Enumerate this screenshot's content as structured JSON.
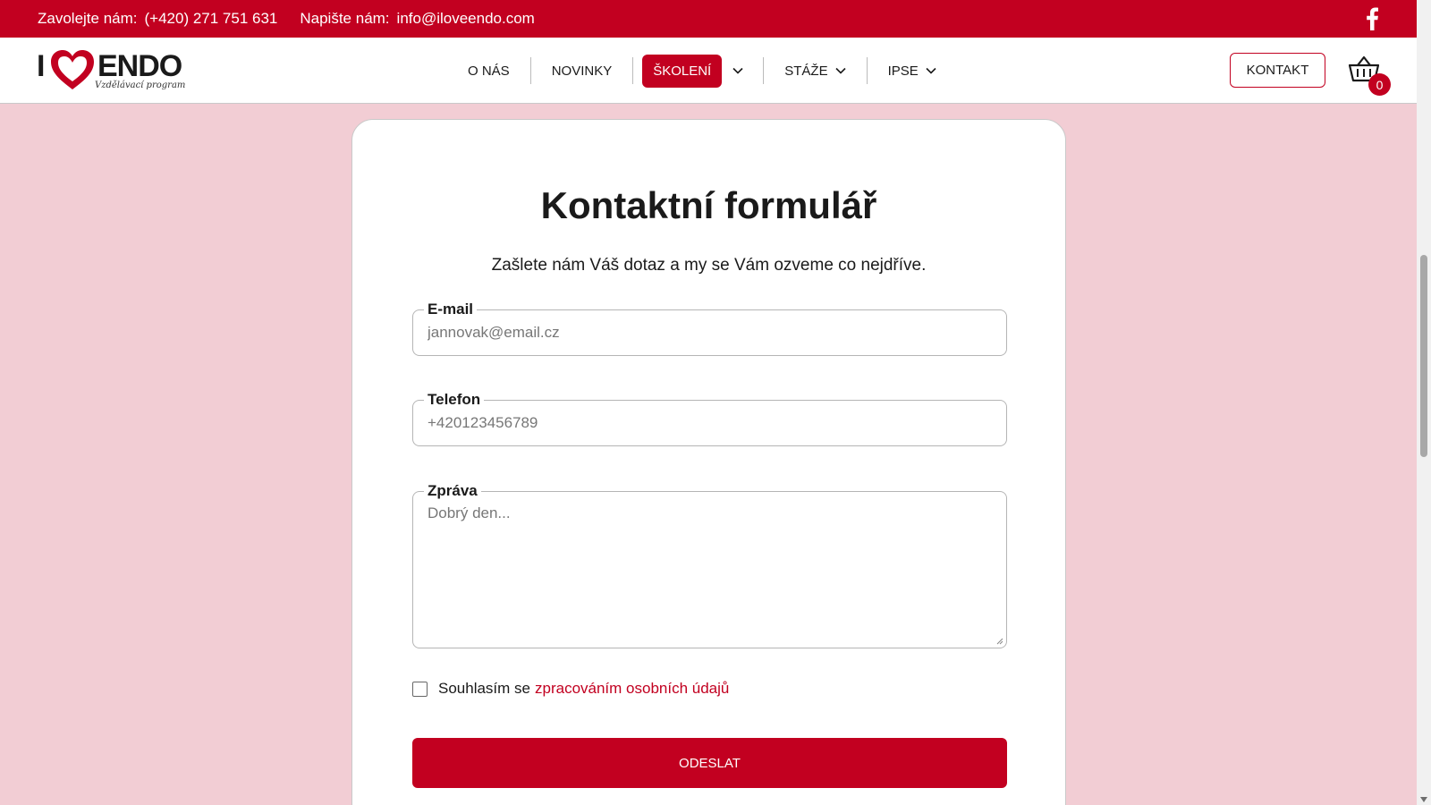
{
  "topbar": {
    "call_label": "Zavolejte nám:",
    "phone": "(+420) 271 751 631",
    "write_label": "Napište nám:",
    "email": "info@iloveendo.com"
  },
  "logo": {
    "letter_i": "I",
    "brand": "ENDO",
    "tagline": "Vzdělávací program"
  },
  "nav": {
    "items": [
      {
        "label": "O nás"
      },
      {
        "label": "Novinky"
      },
      {
        "label": "Školení"
      },
      {
        "label": "Stáže"
      },
      {
        "label": "IPSE"
      }
    ]
  },
  "header": {
    "contact_button": "Kontakt",
    "cart_count": "0"
  },
  "form": {
    "title": "Kontaktní formulář",
    "subtitle": "Zašlete nám Váš dotaz a my se Vám ozveme co nejdříve.",
    "email_label": "E-mail",
    "email_placeholder": "jannovak@email.cz",
    "phone_label": "Telefon",
    "phone_placeholder": "+420123456789",
    "message_label": "Zpráva",
    "message_placeholder": "Dobrý den...",
    "consent_text": "Souhlasím se",
    "consent_link": "zpracováním osobních údajů",
    "submit": "Odeslat"
  },
  "colors": {
    "brand_red": "#c20020",
    "page_bg": "#f2cdd4"
  }
}
